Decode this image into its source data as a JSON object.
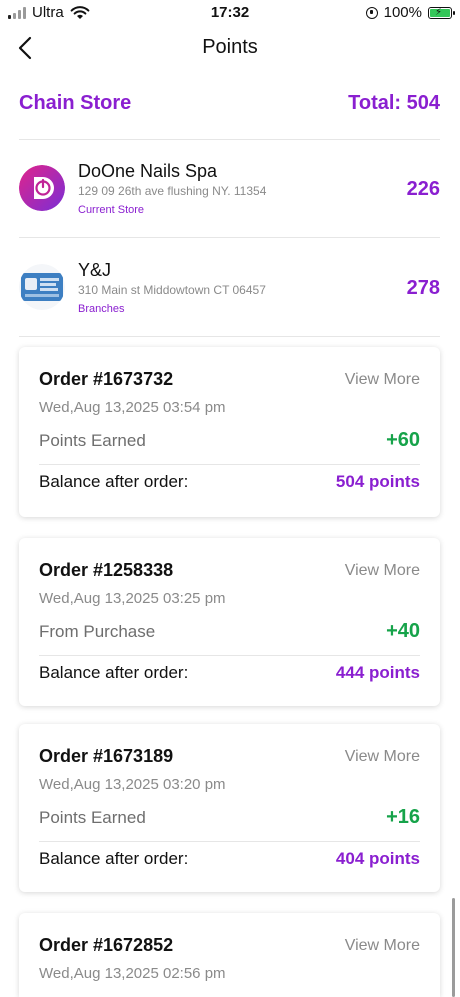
{
  "status_bar": {
    "carrier": "Ultra",
    "time": "17:32",
    "battery": "100%"
  },
  "header": {
    "title": "Points",
    "back_icon": "chevron-left-icon"
  },
  "chain": {
    "title": "Chain Store",
    "total": "Total: 504"
  },
  "stores": [
    {
      "name": "DoOne Nails Spa",
      "address": "129 09 26th ave flushing  NY. 11354",
      "tag": "Current Store",
      "points": "226"
    },
    {
      "name": "Y&J",
      "address": "310 Main st Middowtown CT 06457",
      "tag": "Branches",
      "points": "278"
    }
  ],
  "orders": [
    {
      "order": "Order #1673732",
      "view_more": "View More",
      "date": "Wed,Aug 13,2025 03:54 pm",
      "label": "Points Earned",
      "delta": "+60",
      "balance_label": "Balance after order:",
      "balance": "504 points"
    },
    {
      "order": "Order #1258338",
      "view_more": "View More",
      "date": "Wed,Aug 13,2025 03:25 pm",
      "label": "From Purchase",
      "delta": "+40",
      "balance_label": "Balance after order:",
      "balance": "444 points"
    },
    {
      "order": "Order #1673189",
      "view_more": "View More",
      "date": "Wed,Aug 13,2025 03:20 pm",
      "label": "Points Earned",
      "delta": "+16",
      "balance_label": "Balance after order:",
      "balance": "404 points"
    },
    {
      "order": "Order #1672852",
      "view_more": "View More",
      "date": "Wed,Aug 13,2025 02:56 pm"
    }
  ],
  "colors": {
    "accent": "#8a1fd0",
    "positive": "#16a34a",
    "muted": "#8a8a8a"
  }
}
